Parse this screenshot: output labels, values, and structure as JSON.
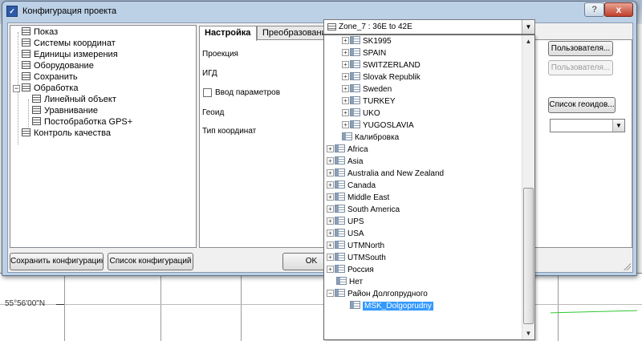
{
  "window": {
    "title": "Конфигурация проекта",
    "help_label": "?",
    "close_label": "x"
  },
  "map": {
    "latitude_label": "55°56'00\"N"
  },
  "sidebar": {
    "items": [
      {
        "label": "Показ"
      },
      {
        "label": "Системы координат"
      },
      {
        "label": "Единицы измерения"
      },
      {
        "label": "Оборудование"
      },
      {
        "label": "Сохранить"
      },
      {
        "label": "Обработка",
        "toggle": "−"
      },
      {
        "label": "Линейный объект"
      },
      {
        "label": "Уравнивание"
      },
      {
        "label": "Постобработка GPS+"
      },
      {
        "label": "Контроль качества"
      }
    ],
    "save_config_label": "Сохранить конфигурацию",
    "config_list_label": "Список конфигураций"
  },
  "tabs": [
    {
      "label": "Настройка"
    },
    {
      "label": "Преобразование"
    }
  ],
  "form": {
    "projection_label": "Проекция",
    "igd_label": "ИГД",
    "input_params_label": "Ввод параметров",
    "geoid_label": "Геоид",
    "coord_type_label": "Тип координат",
    "projection_value": "Zone_7 : 36E to 42E",
    "user_button_label": "Пользователя...",
    "user_button2_label": "Пользователя...",
    "geoid_list_label": "Список геоидов...",
    "ok_label": "OK"
  },
  "dropdown": {
    "items": [
      {
        "label": "SK1995",
        "toggle": "+"
      },
      {
        "label": "SPAIN",
        "toggle": "+"
      },
      {
        "label": "SWITZERLAND",
        "toggle": "+"
      },
      {
        "label": "Slovak Republik",
        "toggle": "+"
      },
      {
        "label": "Sweden",
        "toggle": "+"
      },
      {
        "label": "TURKEY",
        "toggle": "+"
      },
      {
        "label": "UKO",
        "toggle": "+"
      },
      {
        "label": "YUGOSLAVIA",
        "toggle": "+"
      },
      {
        "label": "Калибровка",
        "toggle": ""
      },
      {
        "label": "Africa",
        "toggle": "+"
      },
      {
        "label": "Asia",
        "toggle": "+"
      },
      {
        "label": "Australia and New Zealand",
        "toggle": "+"
      },
      {
        "label": "Canada",
        "toggle": "+"
      },
      {
        "label": "Middle East",
        "toggle": "+"
      },
      {
        "label": "South America",
        "toggle": "+"
      },
      {
        "label": "UPS",
        "toggle": "+"
      },
      {
        "label": "USA",
        "toggle": "+"
      },
      {
        "label": "UTMNorth",
        "toggle": "+"
      },
      {
        "label": "UTMSouth",
        "toggle": "+"
      },
      {
        "label": "Россия",
        "toggle": "+"
      },
      {
        "label": "Нет",
        "toggle": ""
      },
      {
        "label": "Район Долгопрудного",
        "toggle": "−"
      },
      {
        "label": "MSK_Dolgoprudny",
        "toggle": ""
      }
    ],
    "selected": "MSK_Dolgoprudny"
  },
  "colors": {
    "selection": "#3399ff",
    "title_bar": "#bcd0e6"
  }
}
